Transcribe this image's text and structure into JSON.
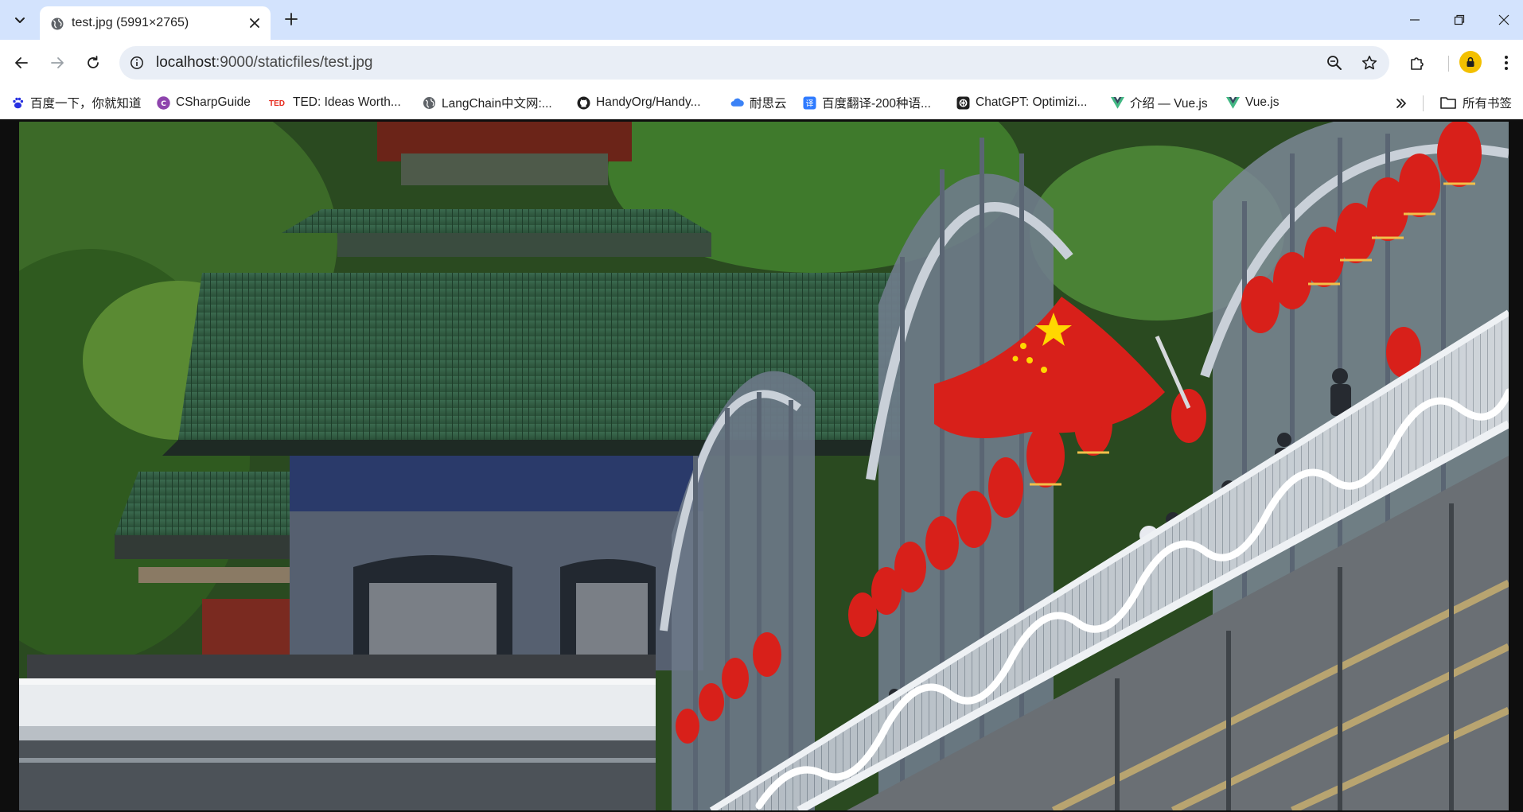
{
  "browser": {
    "tab": {
      "title": "test.jpg (5991×2765)"
    },
    "address": {
      "host": "localhost",
      "path": ":9000/staticfiles/test.jpg"
    },
    "bookmarks": [
      {
        "label": "百度一下，你就知道",
        "icon": "baidu-paw-icon",
        "color": "#2932e1"
      },
      {
        "label": "CSharpGuide",
        "icon": "csharp-icon",
        "color": "#8e44ad"
      },
      {
        "label": "TED: Ideas Worth...",
        "icon": "ted-icon",
        "color": "#e62b1e"
      },
      {
        "label": "LangChain中文网:...",
        "icon": "globe-icon",
        "color": "#5f6368"
      },
      {
        "label": "HandyOrg/Handy...",
        "icon": "github-icon",
        "color": "#1f1f1f"
      },
      {
        "label": "耐思云",
        "icon": "cloud-icon",
        "color": "#3b82f6"
      },
      {
        "label": "百度翻译-200种语...",
        "icon": "translate-icon",
        "color": "#2f7bff"
      },
      {
        "label": "ChatGPT: Optimizi...",
        "icon": "openai-icon",
        "color": "#1f1f1f"
      },
      {
        "label": "介绍 — Vue.js",
        "icon": "vue-icon",
        "color": "#42b883"
      },
      {
        "label": "Vue.js",
        "icon": "vue-icon",
        "color": "#42b883"
      }
    ],
    "all_bookmarks_label": "所有书签"
  },
  "image": {
    "description_icon": "photo",
    "colors": {
      "sky_green": "#3f6b2a",
      "roof_green": "#3e6a4d",
      "flag_red": "#d8201a",
      "bridge_steel": "#9ea9b8",
      "railing_white": "#e8ecef"
    }
  }
}
